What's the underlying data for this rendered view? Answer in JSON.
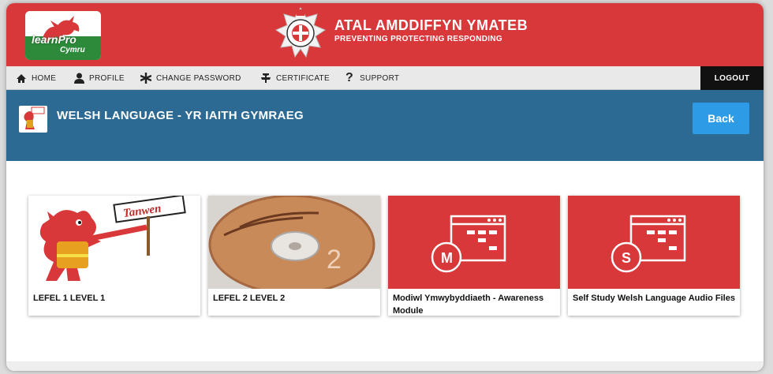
{
  "brand": {
    "logo_main": "learnPro",
    "logo_sub": "Cymru",
    "motto_line1": "ATAL AMDDIFFYN YMATEB",
    "motto_line2": "PREVENTING PROTECTING RESPONDING"
  },
  "nav": {
    "items": [
      {
        "label": "HOME",
        "icon": "home-icon"
      },
      {
        "label": "PROFILE",
        "icon": "user-icon"
      },
      {
        "label": "CHANGE PASSWORD",
        "icon": "asterisk-icon"
      },
      {
        "label": "CERTIFICATE",
        "icon": "certificate-icon"
      },
      {
        "label": "SUPPORT",
        "icon": "question-icon"
      }
    ],
    "logout": "LOGOUT"
  },
  "page": {
    "title": "WELSH LANGUAGE - YR IAITH GYMRAEG",
    "back": "Back"
  },
  "cards": [
    {
      "caption": "LEFEL 1 LEVEL 1",
      "thumb": "dragon-mascot",
      "sign": "Tanwen"
    },
    {
      "caption": "LEFEL 2 LEVEL 2",
      "thumb": "cd-disc",
      "disc_number": "2"
    },
    {
      "caption": "Modiwl Ymwybyddiaeth - Awareness Module",
      "thumb": "module-icon",
      "letter": "M"
    },
    {
      "caption": "Self Study Welsh Language Audio Files",
      "thumb": "module-icon",
      "letter": "S"
    }
  ],
  "colors": {
    "banner": "#d9383a",
    "header": "#2d6a93",
    "back_button": "#2e9be6",
    "logo_green": "#2d8a3a"
  }
}
